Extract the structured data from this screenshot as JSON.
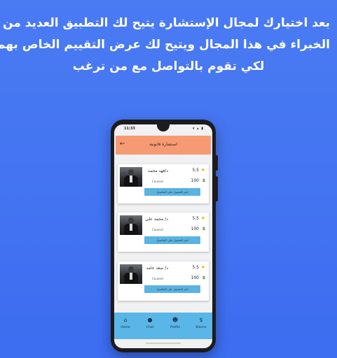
{
  "headline": {
    "line1": "بعد اختيارك لمجال الإستشارة يتيح لك التطبيق العديد من",
    "line2": "الخبراء في هذا المجال ويتيح لك عرض التقييم الخاص بهم",
    "line3": "لكي تقوم بالتواصل مع من ترغب"
  },
  "status_bar": {
    "time": "11:33",
    "icons": "▾ ▴ ▮"
  },
  "app_bar": {
    "title": "استشارة قانونية",
    "back_icon": "arrow-left-icon"
  },
  "colors": {
    "background": "#4a7bf3",
    "app_bar": "#f69a74",
    "button": "#5ab3e0",
    "navbar": "#5ab6e6",
    "star": "#f4b400",
    "dollar": "#3d8b2f"
  },
  "experts": [
    {
      "name": "د/فهد محمد",
      "rating": "5.5",
      "role": "Counsel",
      "price": "100",
      "currency": "$",
      "button": "انقر للحصول على التفاصيل"
    },
    {
      "name": "د/ محمد علي",
      "rating": "5.5",
      "role": "Counsel",
      "price": "100",
      "currency": "$",
      "button": "انقر للحصول على التفاصيل"
    },
    {
      "name": "د/ سعد حامد",
      "rating": "5.5",
      "role": "Counsel",
      "price": "100",
      "currency": "$",
      "button": "انقر للحصول على التفاصيل"
    }
  ],
  "nav": [
    {
      "label": "Home",
      "icon": "home-icon"
    },
    {
      "label": "Chat",
      "icon": "chat-icon"
    },
    {
      "label": "Profile",
      "icon": "profile-icon"
    },
    {
      "label": "Blance",
      "icon": "dollar-icon"
    }
  ]
}
